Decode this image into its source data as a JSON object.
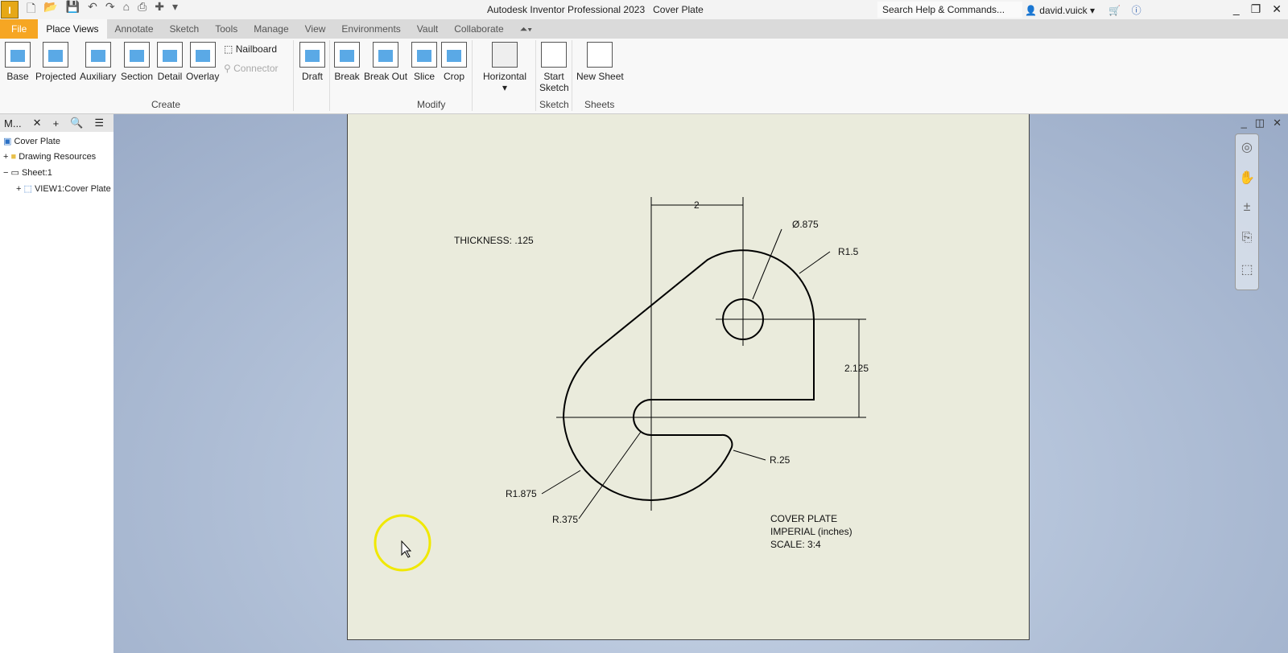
{
  "app": {
    "title": "Autodesk Inventor Professional 2023",
    "document": "Cover Plate",
    "logo": "I",
    "search_placeholder": "Search Help & Commands...",
    "user": "david.vuick"
  },
  "tabs": [
    "File",
    "Place Views",
    "Annotate",
    "Sketch",
    "Tools",
    "Manage",
    "View",
    "Environments",
    "Vault",
    "Collaborate"
  ],
  "ribbon": {
    "create": [
      "Base",
      "Projected",
      "Auxiliary",
      "Section",
      "Detail",
      "Overlay"
    ],
    "nailboard": "Nailboard",
    "connector": "Connector",
    "draft": "Draft",
    "modify": [
      "Break",
      "Break Out",
      "Slice",
      "Crop"
    ],
    "horizontal": "Horizontal",
    "start_sketch": "Start Sketch",
    "new_sheet": "New Sheet",
    "groups": {
      "create": "Create",
      "modify": "Modify",
      "sketch": "Sketch",
      "sheets": "Sheets"
    }
  },
  "browser": {
    "tab": "M...",
    "items": [
      "Cover Plate",
      "Drawing Resources",
      "Sheet:1",
      "VIEW1:Cover Plate"
    ]
  },
  "drawing": {
    "thickness": "THICKNESS: .125",
    "dim_2": "2",
    "dia": "Ø.875",
    "r15": "R1.5",
    "d2125": "2.125",
    "r25": "R.25",
    "r1875": "R1.875",
    "r375": "R.375",
    "title": [
      "COVER PLATE",
      "IMPERIAL (inches)",
      "SCALE: 3:4"
    ]
  },
  "colors": {
    "file_tab": "#f6a623",
    "sheet": "#eaebdc",
    "cursor_highlight": "#f0e800"
  }
}
